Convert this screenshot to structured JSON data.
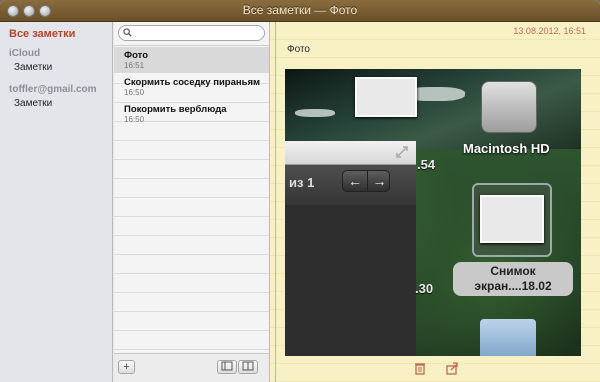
{
  "window": {
    "title": "Все заметки — Фото"
  },
  "sidebar": {
    "all_notes": "Все заметки",
    "accounts": [
      {
        "name": "iCloud",
        "folder": "Заметки"
      },
      {
        "name": "toffler@gmail.com",
        "folder": "Заметки"
      }
    ]
  },
  "notes_list": {
    "search_placeholder": "",
    "notes": [
      {
        "title": "Фото",
        "time": "16:51"
      },
      {
        "title": "Скормить соседку пираньям",
        "time": "16:50"
      },
      {
        "title": "Покормить верблюда",
        "time": "16:50"
      }
    ],
    "add_label": "+"
  },
  "note": {
    "date": "13.08.2012, 16:51",
    "heading": "Фото",
    "image": {
      "nav_text": "из 1",
      "prev_glyph": "←",
      "next_glyph": "→",
      "disk_label": "Macintosh HD",
      "snapshot_label_1": "Снимок",
      "snapshot_label_2": "экран....18.02",
      "number_1": ".54",
      "number_2": ".30"
    }
  },
  "colors": {
    "accent": "#b0472a",
    "paper": "#f7f1c5",
    "date": "#c56a4f"
  }
}
